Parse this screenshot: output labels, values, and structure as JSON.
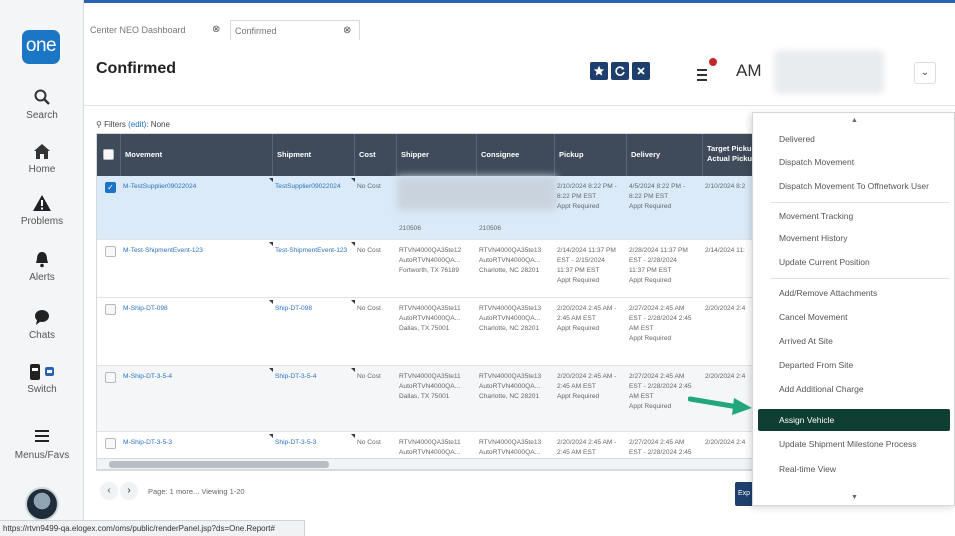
{
  "leftnav": {
    "logo": "one",
    "items": [
      {
        "label": "Search",
        "icon": "search-icon"
      },
      {
        "label": "Home",
        "icon": "home-icon"
      },
      {
        "label": "Problems",
        "icon": "warning-icon"
      },
      {
        "label": "Alerts",
        "icon": "bell-icon"
      },
      {
        "label": "Chats",
        "icon": "chat-icon"
      },
      {
        "label": "Switch",
        "icon": "switch-icon"
      },
      {
        "label": "Menus/Favs",
        "icon": "menu-icon"
      }
    ]
  },
  "tabs": [
    {
      "label": "Center NEO Dashboard",
      "close": "⊗"
    },
    {
      "label": "Confirmed",
      "close": "⊗"
    }
  ],
  "header": {
    "title": "Confirmed",
    "user_initials": "AM",
    "chevron": "⌄"
  },
  "filters": {
    "label": "Filters",
    "edit": "(edit):",
    "value": "None"
  },
  "grid": {
    "columns": [
      "Movement",
      "Shipment",
      "Cost",
      "Shipper",
      "Consignee",
      "Pickup",
      "Delivery",
      "Target Pickup Actual Pickup"
    ],
    "rows": [
      {
        "movement": "M-TestSupplier09022024",
        "shipment": "TestSupplier09022024",
        "cost": "No Cost",
        "shipper": [
          "",
          "",
          "210506"
        ],
        "consignee": [
          "",
          "",
          "210506"
        ],
        "pickup": [
          "2/10/2024 8:22 PM -",
          "8:22 PM EST",
          "Appt Required"
        ],
        "delivery": [
          "4/5/2024 8:22 PM -",
          "8:22 PM EST",
          "Appt Required"
        ],
        "target": "2/10/2024 8:2"
      },
      {
        "movement": "M-Test-ShipmentEvent-123",
        "shipment": "Test-ShipmentEvent-123",
        "cost": "No Cost",
        "shipper": [
          "RTVN4000QA35te12",
          "AutoRTVN4000QA...",
          "Fortworth, TX 76189"
        ],
        "consignee": [
          "RTVN4000QA35te13",
          "AutoRTVN4000QA...",
          "Charlotte, NC 28201"
        ],
        "pickup": [
          "2/14/2024 11:37 PM",
          "EST - 2/15/2024",
          "11:37 PM EST",
          "Appt Required"
        ],
        "delivery": [
          "2/28/2024 11:37 PM",
          "EST - 2/28/2024",
          "11:37 PM EST",
          "Appt Required"
        ],
        "target": "2/14/2024 11:"
      },
      {
        "movement": "M-Ship-DT-098",
        "shipment": "Ship-DT-098",
        "cost": "No Cost",
        "shipper": [
          "RTVN4000QA35te11",
          "AutoRTVN4000QA...",
          "Dallas, TX 75001"
        ],
        "consignee": [
          "RTVN4000QA35te13",
          "AutoRTVN4000QA...",
          "Charlotte, NC 28201"
        ],
        "pickup": [
          "2/20/2024 2:45 AM -",
          "2:45 AM EST",
          "Appt Required"
        ],
        "delivery": [
          "2/27/2024 2:45 AM",
          "EST - 2/28/2024 2:45",
          "AM EST",
          "Appt Required"
        ],
        "target": "2/20/2024 2:4"
      },
      {
        "movement": "M-Ship-DT-3-5-4",
        "shipment": "Ship-DT-3-5-4",
        "cost": "No Cost",
        "shipper": [
          "RTVN4000QA35te11",
          "AutoRTVN4000QA...",
          "Dallas, TX 75001"
        ],
        "consignee": [
          "RTVN4000QA35te13",
          "AutoRTVN4000QA...",
          "Charlotte, NC 28201"
        ],
        "pickup": [
          "2/20/2024 2:45 AM -",
          "2:45 AM EST",
          "Appt Required"
        ],
        "delivery": [
          "2/27/2024 2:45 AM",
          "EST - 2/28/2024 2:45",
          "AM EST",
          "Appt Required"
        ],
        "target": "2/20/2024 2:4"
      },
      {
        "movement": "M-Ship-DT-3-5-3",
        "shipment": "Ship-DT-3-5-3",
        "cost": "No Cost",
        "shipper": [
          "RTVN4000QA35te11",
          "AutoRTVN4000QA..."
        ],
        "consignee": [
          "RTVN4000QA35te13",
          "AutoRTVN4000QA..."
        ],
        "pickup": [
          "2/20/2024 2:45 AM -",
          "2:45 AM EST"
        ],
        "delivery": [
          "2/27/2024 2:45 AM",
          "EST - 2/28/2024 2:45"
        ],
        "target": "2/20/2024 2:4"
      }
    ]
  },
  "pager": {
    "prev": "‹",
    "next": "›",
    "text": "Page: 1 more... Viewing 1-20"
  },
  "export_label": "Exp",
  "dropdown": {
    "items": [
      "Delivered",
      "Dispatch Movement",
      "Dispatch Movement To Offnetwork User",
      "Movement Tracking",
      "Movement History",
      "Update Current Position",
      "Add/Remove Attachments",
      "Cancel Movement",
      "Arrived At Site",
      "Departed From Site",
      "Add Additional Charge",
      "Assign Vehicle",
      "Update Shipment Milestone Process",
      "Real-time View"
    ],
    "highlighted": "Assign Vehicle"
  },
  "statusbar": "https://rtvn9499-qa.elogex.com/oms/public/renderPanel.jsp?ds=One.Report#",
  "colors": {
    "nav_blue": "#1b77c5",
    "header_dark": "#3f4b5a",
    "highlight": "#0f3e32",
    "arrow": "#22a77c"
  }
}
